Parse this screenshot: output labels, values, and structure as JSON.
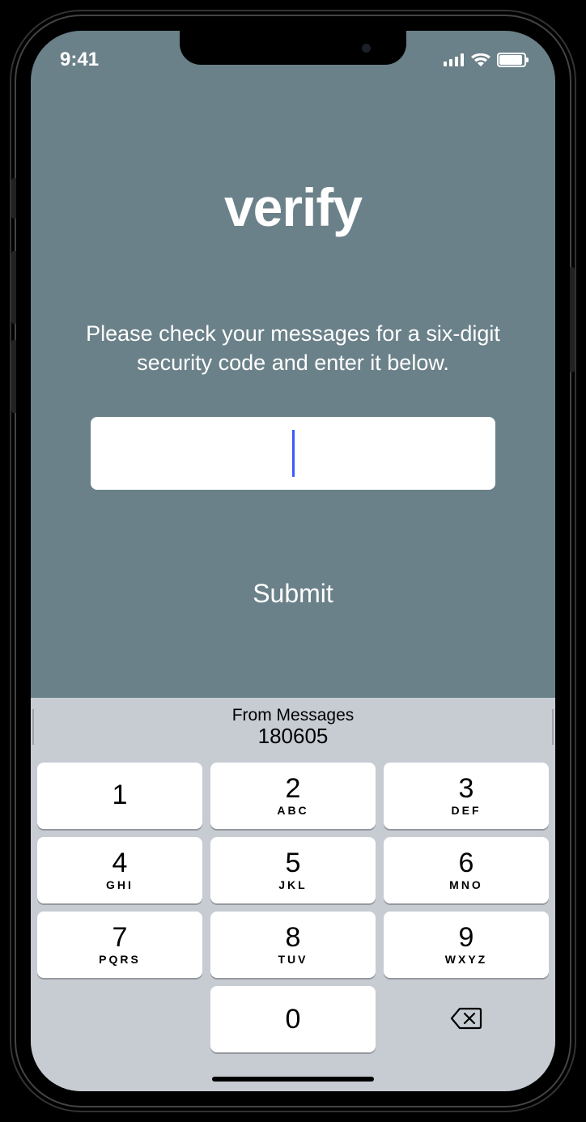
{
  "status_bar": {
    "time": "9:41"
  },
  "page": {
    "title": "verify",
    "subtitle": "Please check your messages for a six-digit security code and enter it below.",
    "input_value": "",
    "submit_label": "Submit"
  },
  "keyboard": {
    "suggestion_label": "From Messages",
    "suggestion_code": "180605",
    "keys": [
      {
        "num": "1",
        "letters": ""
      },
      {
        "num": "2",
        "letters": "ABC"
      },
      {
        "num": "3",
        "letters": "DEF"
      },
      {
        "num": "4",
        "letters": "GHI"
      },
      {
        "num": "5",
        "letters": "JKL"
      },
      {
        "num": "6",
        "letters": "MNO"
      },
      {
        "num": "7",
        "letters": "PQRS"
      },
      {
        "num": "8",
        "letters": "TUV"
      },
      {
        "num": "9",
        "letters": "WXYZ"
      },
      {
        "num": "0",
        "letters": ""
      }
    ]
  }
}
